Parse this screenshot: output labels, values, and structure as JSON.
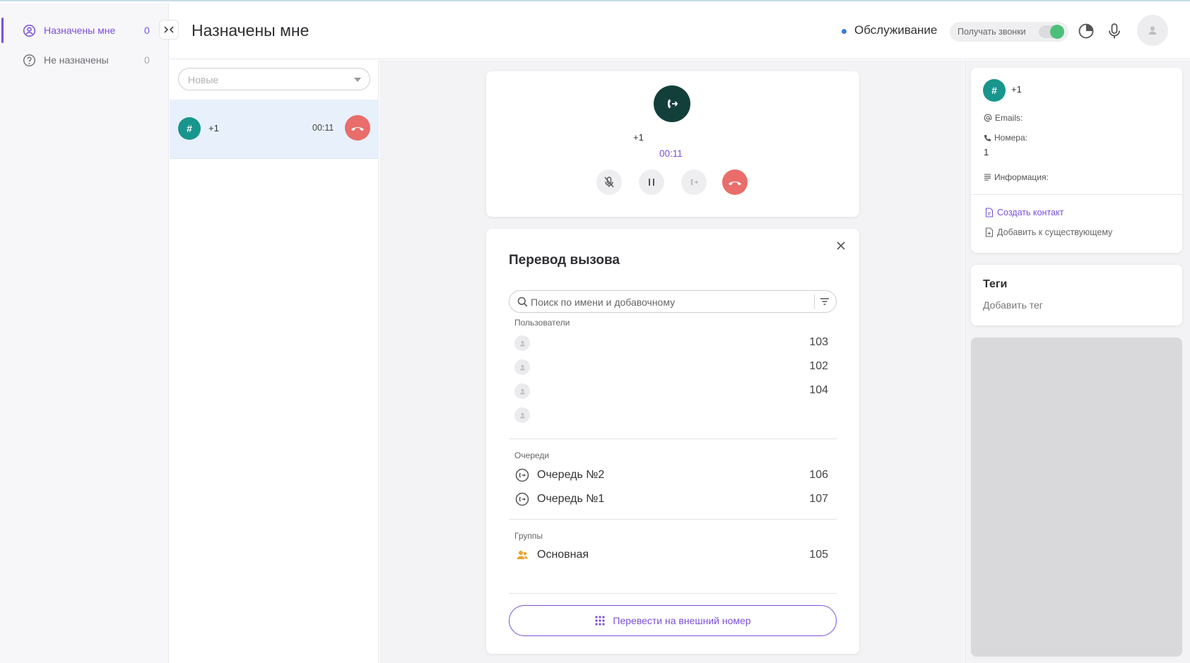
{
  "sidebar": {
    "items": [
      {
        "label": "Назначены мне",
        "count": "0",
        "active": true
      },
      {
        "label": "Не назначены",
        "count": "0",
        "active": false
      }
    ]
  },
  "header": {
    "title": "Назначены мне",
    "status": "Обслуживание",
    "receive_calls_label": "Получать звонки",
    "receive_calls_on": true
  },
  "calls_list": {
    "filter_placeholder": "Новые",
    "items": [
      {
        "avatar": "#",
        "number": "+1",
        "duration": "00:11"
      }
    ]
  },
  "active_call": {
    "number": "+1",
    "duration": "00:11"
  },
  "transfer": {
    "title": "Перевод вызова",
    "search_placeholder": "Поиск по имени и добавочному",
    "users_label": "Пользователи",
    "users": [
      {
        "ext": "103"
      },
      {
        "ext": "102"
      },
      {
        "ext": "104"
      },
      {
        "ext": ""
      }
    ],
    "queues_label": "Очереди",
    "queues": [
      {
        "name": "Очередь №2",
        "ext": "106"
      },
      {
        "name": "Очередь №1",
        "ext": "107"
      }
    ],
    "groups_label": "Группы",
    "groups": [
      {
        "name": "Основная",
        "ext": "105"
      }
    ],
    "external_button": "Перевести на внешний номер"
  },
  "contact": {
    "avatar": "#",
    "number": "+1",
    "emails_label": "Emails:",
    "numbers_label": "Номера:",
    "numbers_value": "1",
    "info_label": "Информация:",
    "create_link": "Создать контакт",
    "add_existing_link": "Добавить к существующему"
  },
  "tags": {
    "title": "Теги",
    "add_label": "Добавить тег"
  },
  "colors": {
    "accent": "#7b4fd9",
    "hangup": "#e96d6a",
    "avatar_teal": "#18958c",
    "toggle_on": "#4cc07a",
    "status_dot": "#3b7bd9"
  }
}
